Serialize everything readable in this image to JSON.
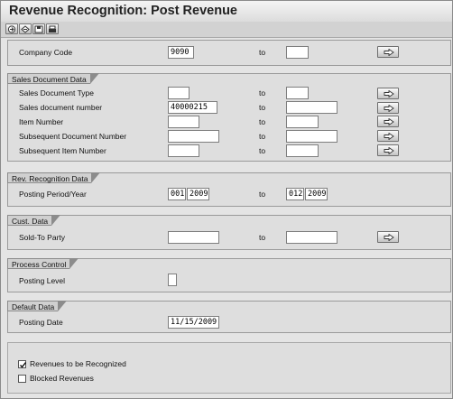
{
  "window": {
    "title": "Revenue Recognition: Post Revenue"
  },
  "toolbar": {
    "icons": [
      "execute-icon",
      "variant-icon",
      "save-icon",
      "print-icon"
    ]
  },
  "common": {
    "to_label": "to"
  },
  "company": {
    "label": "Company Code",
    "from_value": "9090",
    "to_value": ""
  },
  "sales_doc": {
    "title": "Sales Document Data",
    "rows": [
      {
        "label": "Sales Document Type",
        "from_value": "",
        "to_value": ""
      },
      {
        "label": "Sales document number",
        "from_value": "40000215",
        "to_value": ""
      },
      {
        "label": "Item Number",
        "from_value": "",
        "to_value": ""
      },
      {
        "label": "Subsequent Document Number",
        "from_value": "",
        "to_value": ""
      },
      {
        "label": "Subsequent Item Number",
        "from_value": "",
        "to_value": ""
      }
    ]
  },
  "rev_rec": {
    "title": "Rev. Recognition Data",
    "label": "Posting Period/Year",
    "from_period": "001",
    "from_year": "2009",
    "to_period": "012",
    "to_year": "2009"
  },
  "cust": {
    "title": "Cust. Data",
    "label": "Sold-To Party",
    "from_value": "",
    "to_value": ""
  },
  "process": {
    "title": "Process Control",
    "label": "Posting Level",
    "value": ""
  },
  "defaults": {
    "title": "Default Data",
    "label": "Posting Date",
    "value": "11/15/2009"
  },
  "options": {
    "revenues_label": "Revenues to be Recognized",
    "revenues_checked": true,
    "blocked_label": "Blocked Revenues",
    "blocked_checked": false
  }
}
